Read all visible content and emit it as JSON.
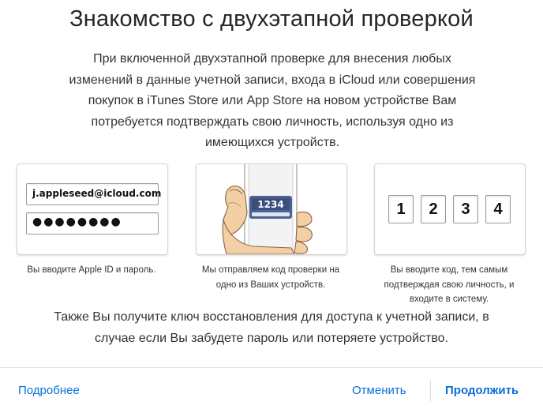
{
  "dialog": {
    "title": "Знакомство с двухэтапной проверкой",
    "intro_lines": [
      "При включенной двухэтапной проверке для внесения любых",
      "изменений в данные учетной записи, входа в iCloud или совершения",
      "покупок в iTunes Store или App Store на новом устройстве Вам",
      "потребуется подтверждать свою личность, используя одно из",
      "имеющихся устройств."
    ],
    "steps": [
      {
        "apple_id": "j.appleseed@icloud.com",
        "password_mask": "●●●●●●●●",
        "caption_lines": [
          "Вы вводите Apple ID и пароль."
        ]
      },
      {
        "phone_code": "1234",
        "caption_lines": [
          "Мы отправляем код проверки на",
          "одно из Ваших устройств."
        ]
      },
      {
        "digits": [
          "1",
          "2",
          "3",
          "4"
        ],
        "caption_lines": [
          "Вы вводите код, тем самым",
          "подтверждая свою личность, и",
          "входите в систему."
        ]
      }
    ],
    "outro_lines": [
      "Также Вы получите ключ восстановления для доступа к учетной записи, в",
      "случае если Вы забудете пароль или потеряете устройство."
    ]
  },
  "footer": {
    "more_label": "Подробнее",
    "cancel_label": "Отменить",
    "continue_label": "Продолжить"
  },
  "colors": {
    "link": "#0a6fd8",
    "phone_code_badge": "#4b6193",
    "text": "#333333"
  },
  "icons": [
    "hand-holding-phone-illustration"
  ]
}
